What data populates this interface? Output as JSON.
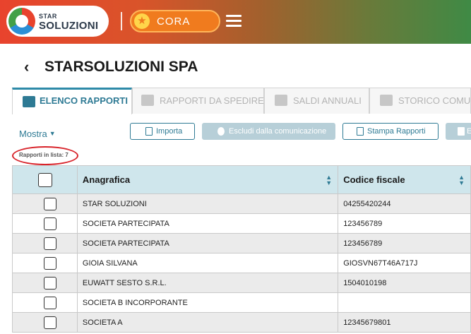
{
  "header": {
    "logo_small": "STAR",
    "logo_big": "SOLUZIONI",
    "app_button": "CORA"
  },
  "page": {
    "title": "STARSOLUZIONI SPA"
  },
  "tabs": [
    {
      "label": "ELENCO RAPPORTI",
      "active": true
    },
    {
      "label": "RAPPORTI DA SPEDIRE",
      "active": false
    },
    {
      "label": "SALDI ANNUALI",
      "active": false
    },
    {
      "label": "STORICO COMUN",
      "active": false
    }
  ],
  "toolbar": {
    "mostra": "Mostra",
    "importa": "Importa",
    "escludi": "Escludi dalla comunicazione",
    "stampa": "Stampa Rapporti",
    "e_label": "E"
  },
  "count_label": "Rapporti in lista: 7",
  "table": {
    "columns": [
      "Anagrafica",
      "Codice fiscale"
    ],
    "rows": [
      {
        "anagrafica": "STAR SOLUZIONI",
        "cf": "04255420244"
      },
      {
        "anagrafica": "SOCIETA PARTECIPATA",
        "cf": "123456789"
      },
      {
        "anagrafica": "SOCIETA PARTECIPATA",
        "cf": "123456789"
      },
      {
        "anagrafica": "GIOIA SILVANA",
        "cf": "GIOSVN67T46A717J"
      },
      {
        "anagrafica": "EUWATT SESTO S.R.L.",
        "cf": "1504010198"
      },
      {
        "anagrafica": "SOCIETA B INCORPORANTE",
        "cf": ""
      },
      {
        "anagrafica": "SOCIETA A",
        "cf": "12345679801"
      }
    ]
  },
  "colors": {
    "accent": "#2e7a94",
    "header_row": "#cfe6ec",
    "highlight_circle": "#d8232a",
    "cora_orange": "#f07b1e"
  },
  "icons": {
    "logo": "starsoluzioni-logo-icon",
    "cora": "star-icon",
    "menu": "hamburger-menu-icon",
    "back": "chevron-left-icon"
  }
}
